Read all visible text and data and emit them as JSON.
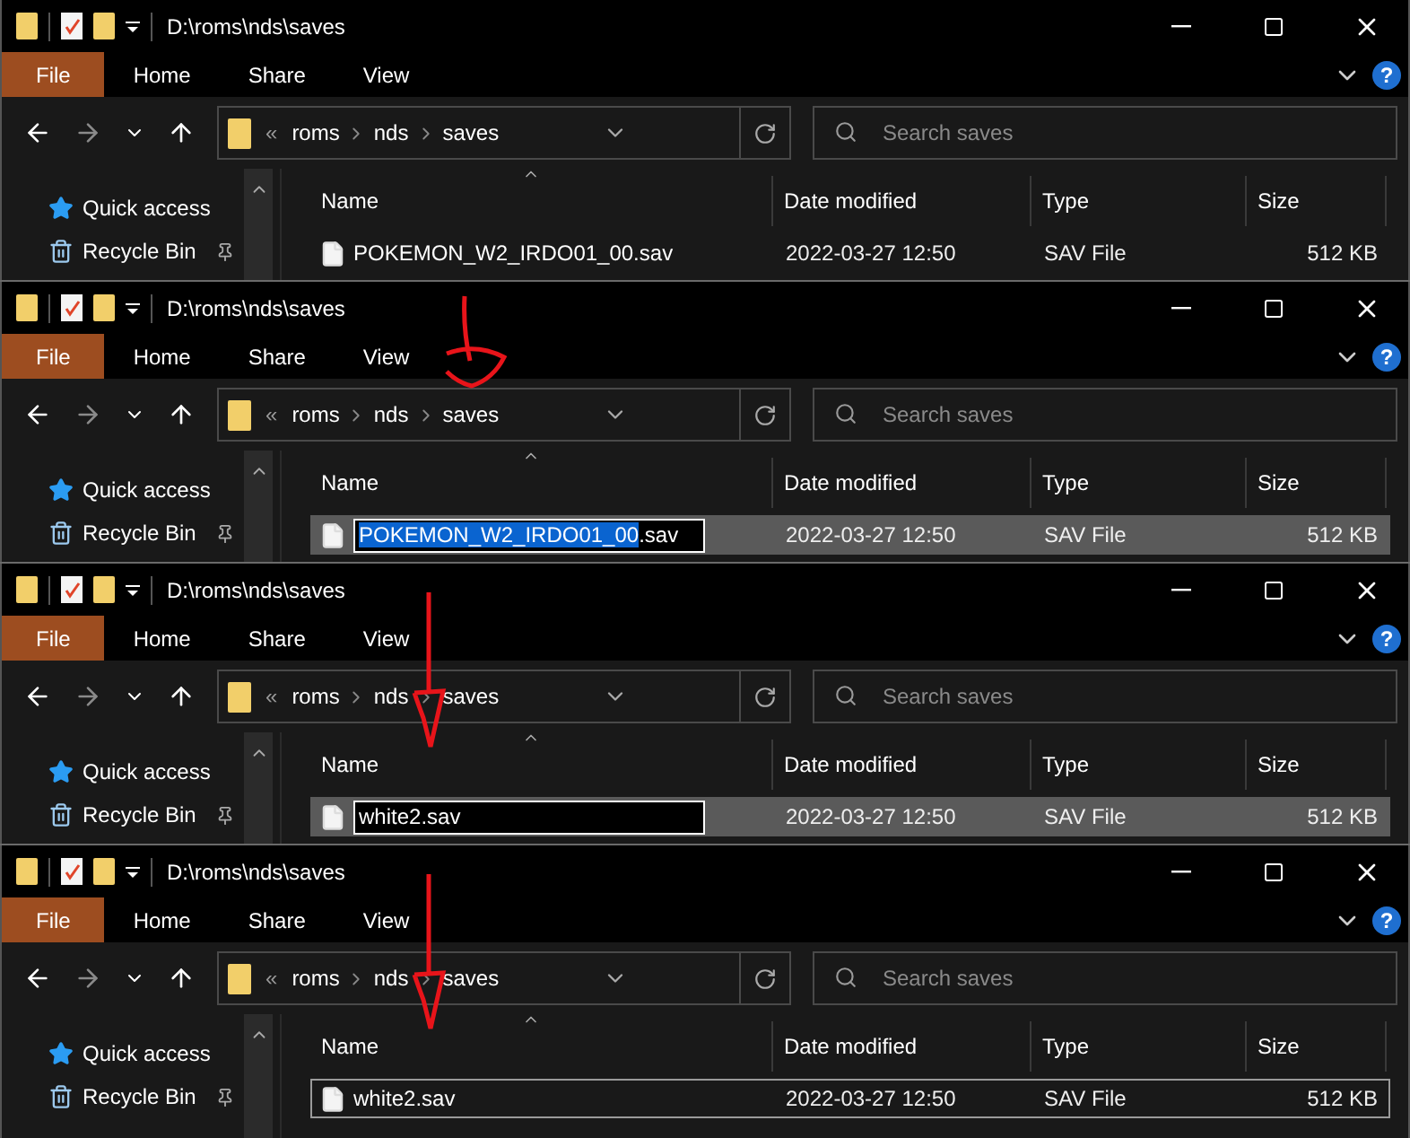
{
  "panels": [
    {
      "title": "D:\\roms\\nds\\saves",
      "tabs": [
        {
          "label": "File",
          "selected": true
        },
        {
          "label": "Home",
          "selected": false
        },
        {
          "label": "Share",
          "selected": false
        },
        {
          "label": "View",
          "selected": false
        }
      ],
      "help_glyph": "?",
      "overflow_glyph": "«",
      "breadcrumb": [
        "roms",
        "nds",
        "saves"
      ],
      "search": {
        "placeholder": "Search saves"
      },
      "columns": [
        "Name",
        "Date modified",
        "Type",
        "Size"
      ],
      "sidebar": [
        {
          "label": "Quick access",
          "kind": "quick"
        },
        {
          "label": "Recycle Bin",
          "kind": "bin"
        }
      ],
      "rows": [
        {
          "name_parts": [
            {
              "text": "POKEMON_W2_IRDO01_00.sav",
              "highlighted": false
            }
          ],
          "date": "2022-03-27 12:50",
          "type": "SAV File",
          "size": "512 KB",
          "selected": false,
          "editing": false,
          "focused": false
        }
      ]
    },
    {
      "title": "D:\\roms\\nds\\saves",
      "tabs": [
        {
          "label": "File",
          "selected": true
        },
        {
          "label": "Home",
          "selected": false
        },
        {
          "label": "Share",
          "selected": false
        },
        {
          "label": "View",
          "selected": false
        }
      ],
      "help_glyph": "?",
      "overflow_glyph": "«",
      "breadcrumb": [
        "roms",
        "nds",
        "saves"
      ],
      "search": {
        "placeholder": "Search saves"
      },
      "columns": [
        "Name",
        "Date modified",
        "Type",
        "Size"
      ],
      "sidebar": [
        {
          "label": "Quick access",
          "kind": "quick"
        },
        {
          "label": "Recycle Bin",
          "kind": "bin"
        }
      ],
      "annotation": {
        "kind": "hook"
      },
      "rows": [
        {
          "name_parts": [
            {
              "text": "POKEMON_W2_IRDO01_00",
              "highlighted": true
            },
            {
              "text": ".sav",
              "highlighted": false
            }
          ],
          "date": "2022-03-27 12:50",
          "type": "SAV File",
          "size": "512 KB",
          "selected": true,
          "editing": true,
          "focused": false
        }
      ]
    },
    {
      "title": "D:\\roms\\nds\\saves",
      "tabs": [
        {
          "label": "File",
          "selected": true
        },
        {
          "label": "Home",
          "selected": false
        },
        {
          "label": "Share",
          "selected": false
        },
        {
          "label": "View",
          "selected": false
        }
      ],
      "help_glyph": "?",
      "overflow_glyph": "«",
      "breadcrumb": [
        "roms",
        "nds",
        "saves"
      ],
      "search": {
        "placeholder": "Search saves"
      },
      "columns": [
        "Name",
        "Date modified",
        "Type",
        "Size"
      ],
      "sidebar": [
        {
          "label": "Quick access",
          "kind": "quick"
        },
        {
          "label": "Recycle Bin",
          "kind": "bin"
        }
      ],
      "annotation": {
        "kind": "triangle"
      },
      "rows": [
        {
          "name_parts": [
            {
              "text": "white2.sav",
              "highlighted": false
            }
          ],
          "date": "2022-03-27 12:50",
          "type": "SAV File",
          "size": "512 KB",
          "selected": true,
          "editing": true,
          "focused": false
        }
      ]
    },
    {
      "title": "D:\\roms\\nds\\saves",
      "tabs": [
        {
          "label": "File",
          "selected": true
        },
        {
          "label": "Home",
          "selected": false
        },
        {
          "label": "Share",
          "selected": false
        },
        {
          "label": "View",
          "selected": false
        }
      ],
      "help_glyph": "?",
      "overflow_glyph": "«",
      "breadcrumb": [
        "roms",
        "nds",
        "saves"
      ],
      "search": {
        "placeholder": "Search saves"
      },
      "columns": [
        "Name",
        "Date modified",
        "Type",
        "Size"
      ],
      "sidebar": [
        {
          "label": "Quick access",
          "kind": "quick"
        },
        {
          "label": "Recycle Bin",
          "kind": "bin"
        }
      ],
      "annotation": {
        "kind": "triangle"
      },
      "rows": [
        {
          "name_parts": [
            {
              "text": "white2.sav",
              "highlighted": false
            }
          ],
          "date": "2022-03-27 12:50",
          "type": "SAV File",
          "size": "512 KB",
          "selected": false,
          "editing": false,
          "focused": true
        }
      ]
    }
  ]
}
